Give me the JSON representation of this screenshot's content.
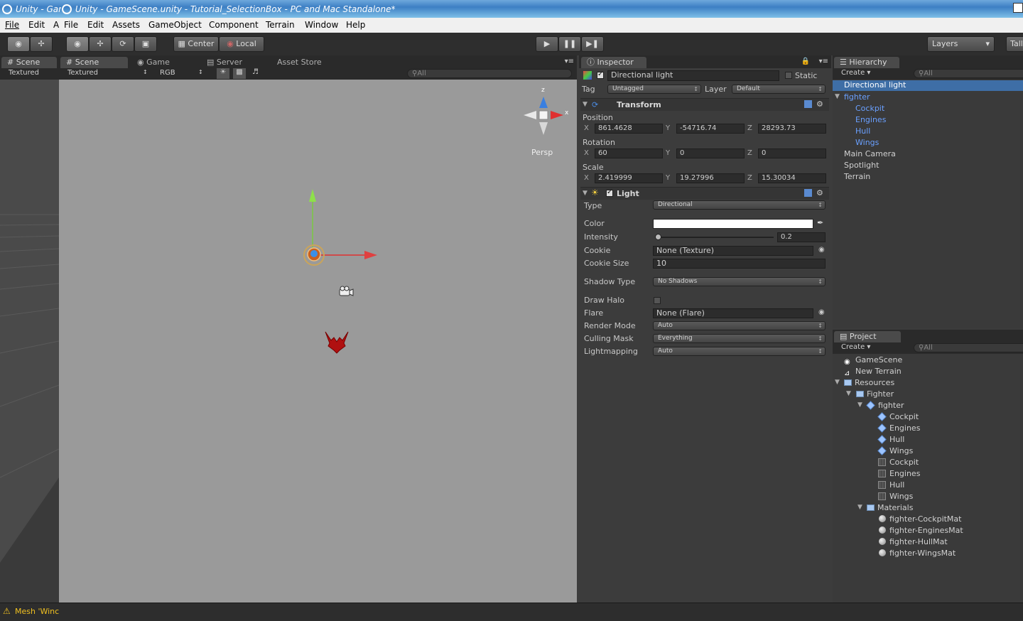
{
  "window": {
    "tab1_title": "Unity - Gam",
    "tab2_title": "Unity - GameScene.unity - Tutorial_SelectionBox - PC and Mac Standalone*"
  },
  "menubar": {
    "left_menu": [
      "File",
      "Edit",
      "A"
    ],
    "items": [
      "File",
      "Edit",
      "Assets",
      "GameObject",
      "Component",
      "Terrain",
      "Window",
      "Help"
    ]
  },
  "toolbar": {
    "center_label": "Center",
    "local_label": "Local",
    "layers_label": "Layers",
    "layout_label": "Tall"
  },
  "scene_left": {
    "tab": "Scene",
    "render_mode": "Textured"
  },
  "scene": {
    "tabs": [
      "Scene",
      "Game",
      "Server",
      "Asset Store"
    ],
    "render_mode": "Textured",
    "color_mode": "RGB",
    "search_placeholder": "All",
    "gizmo_label": "Persp",
    "gizmo_axes": {
      "x": "x",
      "z": "z"
    }
  },
  "inspector": {
    "tab": "Inspector",
    "object_name": "Directional light",
    "static_label": "Static",
    "tag_label": "Tag",
    "tag_value": "Untagged",
    "layer_label": "Layer",
    "layer_value": "Default",
    "transform": {
      "title": "Transform",
      "position_label": "Position",
      "position": {
        "x": "861.4628",
        "y": "-54716.74",
        "z": "28293.73"
      },
      "rotation_label": "Rotation",
      "rotation": {
        "x": "60",
        "y": "0",
        "z": "0"
      },
      "scale_label": "Scale",
      "scale": {
        "x": "2.419999",
        "y": "19.27996",
        "z": "15.30034"
      },
      "axis_x": "X",
      "axis_y": "Y",
      "axis_z": "Z"
    },
    "light": {
      "title": "Light",
      "type_label": "Type",
      "type_value": "Directional",
      "color_label": "Color",
      "color_value": "#ffffff",
      "intensity_label": "Intensity",
      "intensity_value": "0.2",
      "intensity_fraction": 0.025,
      "cookie_label": "Cookie",
      "cookie_value": "None (Texture)",
      "cookie_size_label": "Cookie Size",
      "cookie_size_value": "10",
      "shadow_type_label": "Shadow Type",
      "shadow_type_value": "No Shadows",
      "draw_halo_label": "Draw Halo",
      "flare_label": "Flare",
      "flare_value": "None (Flare)",
      "render_mode_label": "Render Mode",
      "render_mode_value": "Auto",
      "culling_mask_label": "Culling Mask",
      "culling_mask_value": "Everything",
      "lightmapping_label": "Lightmapping",
      "lightmapping_value": "Auto"
    }
  },
  "hierarchy": {
    "tab": "Hierarchy",
    "create_label": "Create",
    "search_placeholder": "All",
    "items": [
      {
        "label": "Directional light"
      },
      {
        "label": "fighter"
      },
      {
        "label": "Cockpit"
      },
      {
        "label": "Engines"
      },
      {
        "label": "Hull"
      },
      {
        "label": "Wings"
      },
      {
        "label": "Main Camera"
      },
      {
        "label": "Spotlight"
      },
      {
        "label": "Terrain"
      }
    ]
  },
  "project": {
    "tab": "Project",
    "create_label": "Create",
    "search_placeholder": "All",
    "items": [
      {
        "label": "GameScene",
        "icon": "unity-scene-icon"
      },
      {
        "label": "New Terrain",
        "icon": "terrain-icon"
      },
      {
        "label": "Resources",
        "icon": "folder-icon"
      },
      {
        "label": "Fighter",
        "icon": "folder-icon"
      },
      {
        "label": "fighter",
        "icon": "prefab-icon"
      },
      {
        "label": "Cockpit",
        "icon": "prefab-icon"
      },
      {
        "label": "Engines",
        "icon": "prefab-icon"
      },
      {
        "label": "Hull",
        "icon": "prefab-icon"
      },
      {
        "label": "Wings",
        "icon": "prefab-icon"
      },
      {
        "label": "Cockpit",
        "icon": "mesh-icon"
      },
      {
        "label": "Engines",
        "icon": "mesh-icon"
      },
      {
        "label": "Hull",
        "icon": "mesh-icon"
      },
      {
        "label": "Wings",
        "icon": "mesh-icon"
      },
      {
        "label": "Materials",
        "icon": "folder-icon"
      },
      {
        "label": "fighter-CockpitMat",
        "icon": "material-icon"
      },
      {
        "label": "fighter-EnginesMat",
        "icon": "material-icon"
      },
      {
        "label": "fighter-HullMat",
        "icon": "material-icon"
      },
      {
        "label": "fighter-WingsMat",
        "icon": "material-icon"
      }
    ]
  },
  "status": {
    "message": "Mesh 'Winc"
  }
}
